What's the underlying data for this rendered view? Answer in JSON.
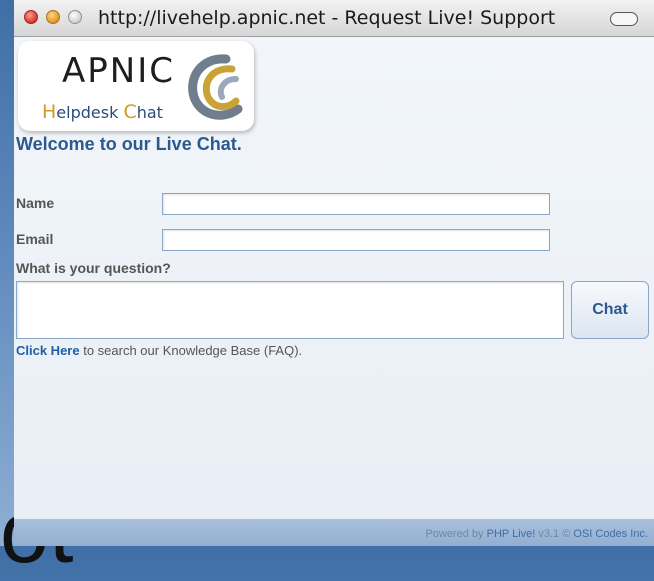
{
  "window": {
    "title": "http://livehelp.apnic.net - Request Live! Support"
  },
  "logo": {
    "name": "APNIC",
    "subtitle_h": "H",
    "subtitle_elpdesk": "elpdesk ",
    "subtitle_c": "C",
    "subtitle_hat": "hat"
  },
  "page": {
    "welcome": "Welcome to our Live Chat."
  },
  "form": {
    "name_label": "Name",
    "name_value": "",
    "email_label": "Email",
    "email_value": "",
    "question_label": "What is your question?",
    "question_value": "",
    "chat_button": "Chat"
  },
  "kb": {
    "link_text": "Click Here",
    "suffix": " to search our Knowledge Base (FAQ)."
  },
  "footer": {
    "prefix": "Powered by ",
    "product": "PHP Live!",
    "middle": " v3.1 © ",
    "company": "OSI Codes Inc."
  },
  "background": {
    "partial_text": "ot"
  },
  "colors": {
    "accent": "#2a5a8e",
    "link": "#1f5fa8",
    "footer_bg": "#a8c0dc",
    "logo_gold": "#d29a22"
  },
  "icons": {
    "close": "close-icon",
    "minimize": "minimize-icon",
    "zoom": "zoom-icon",
    "toolbar_toggle": "toolbar-toggle-icon",
    "logo_swirl": "swirl-logo-icon"
  }
}
